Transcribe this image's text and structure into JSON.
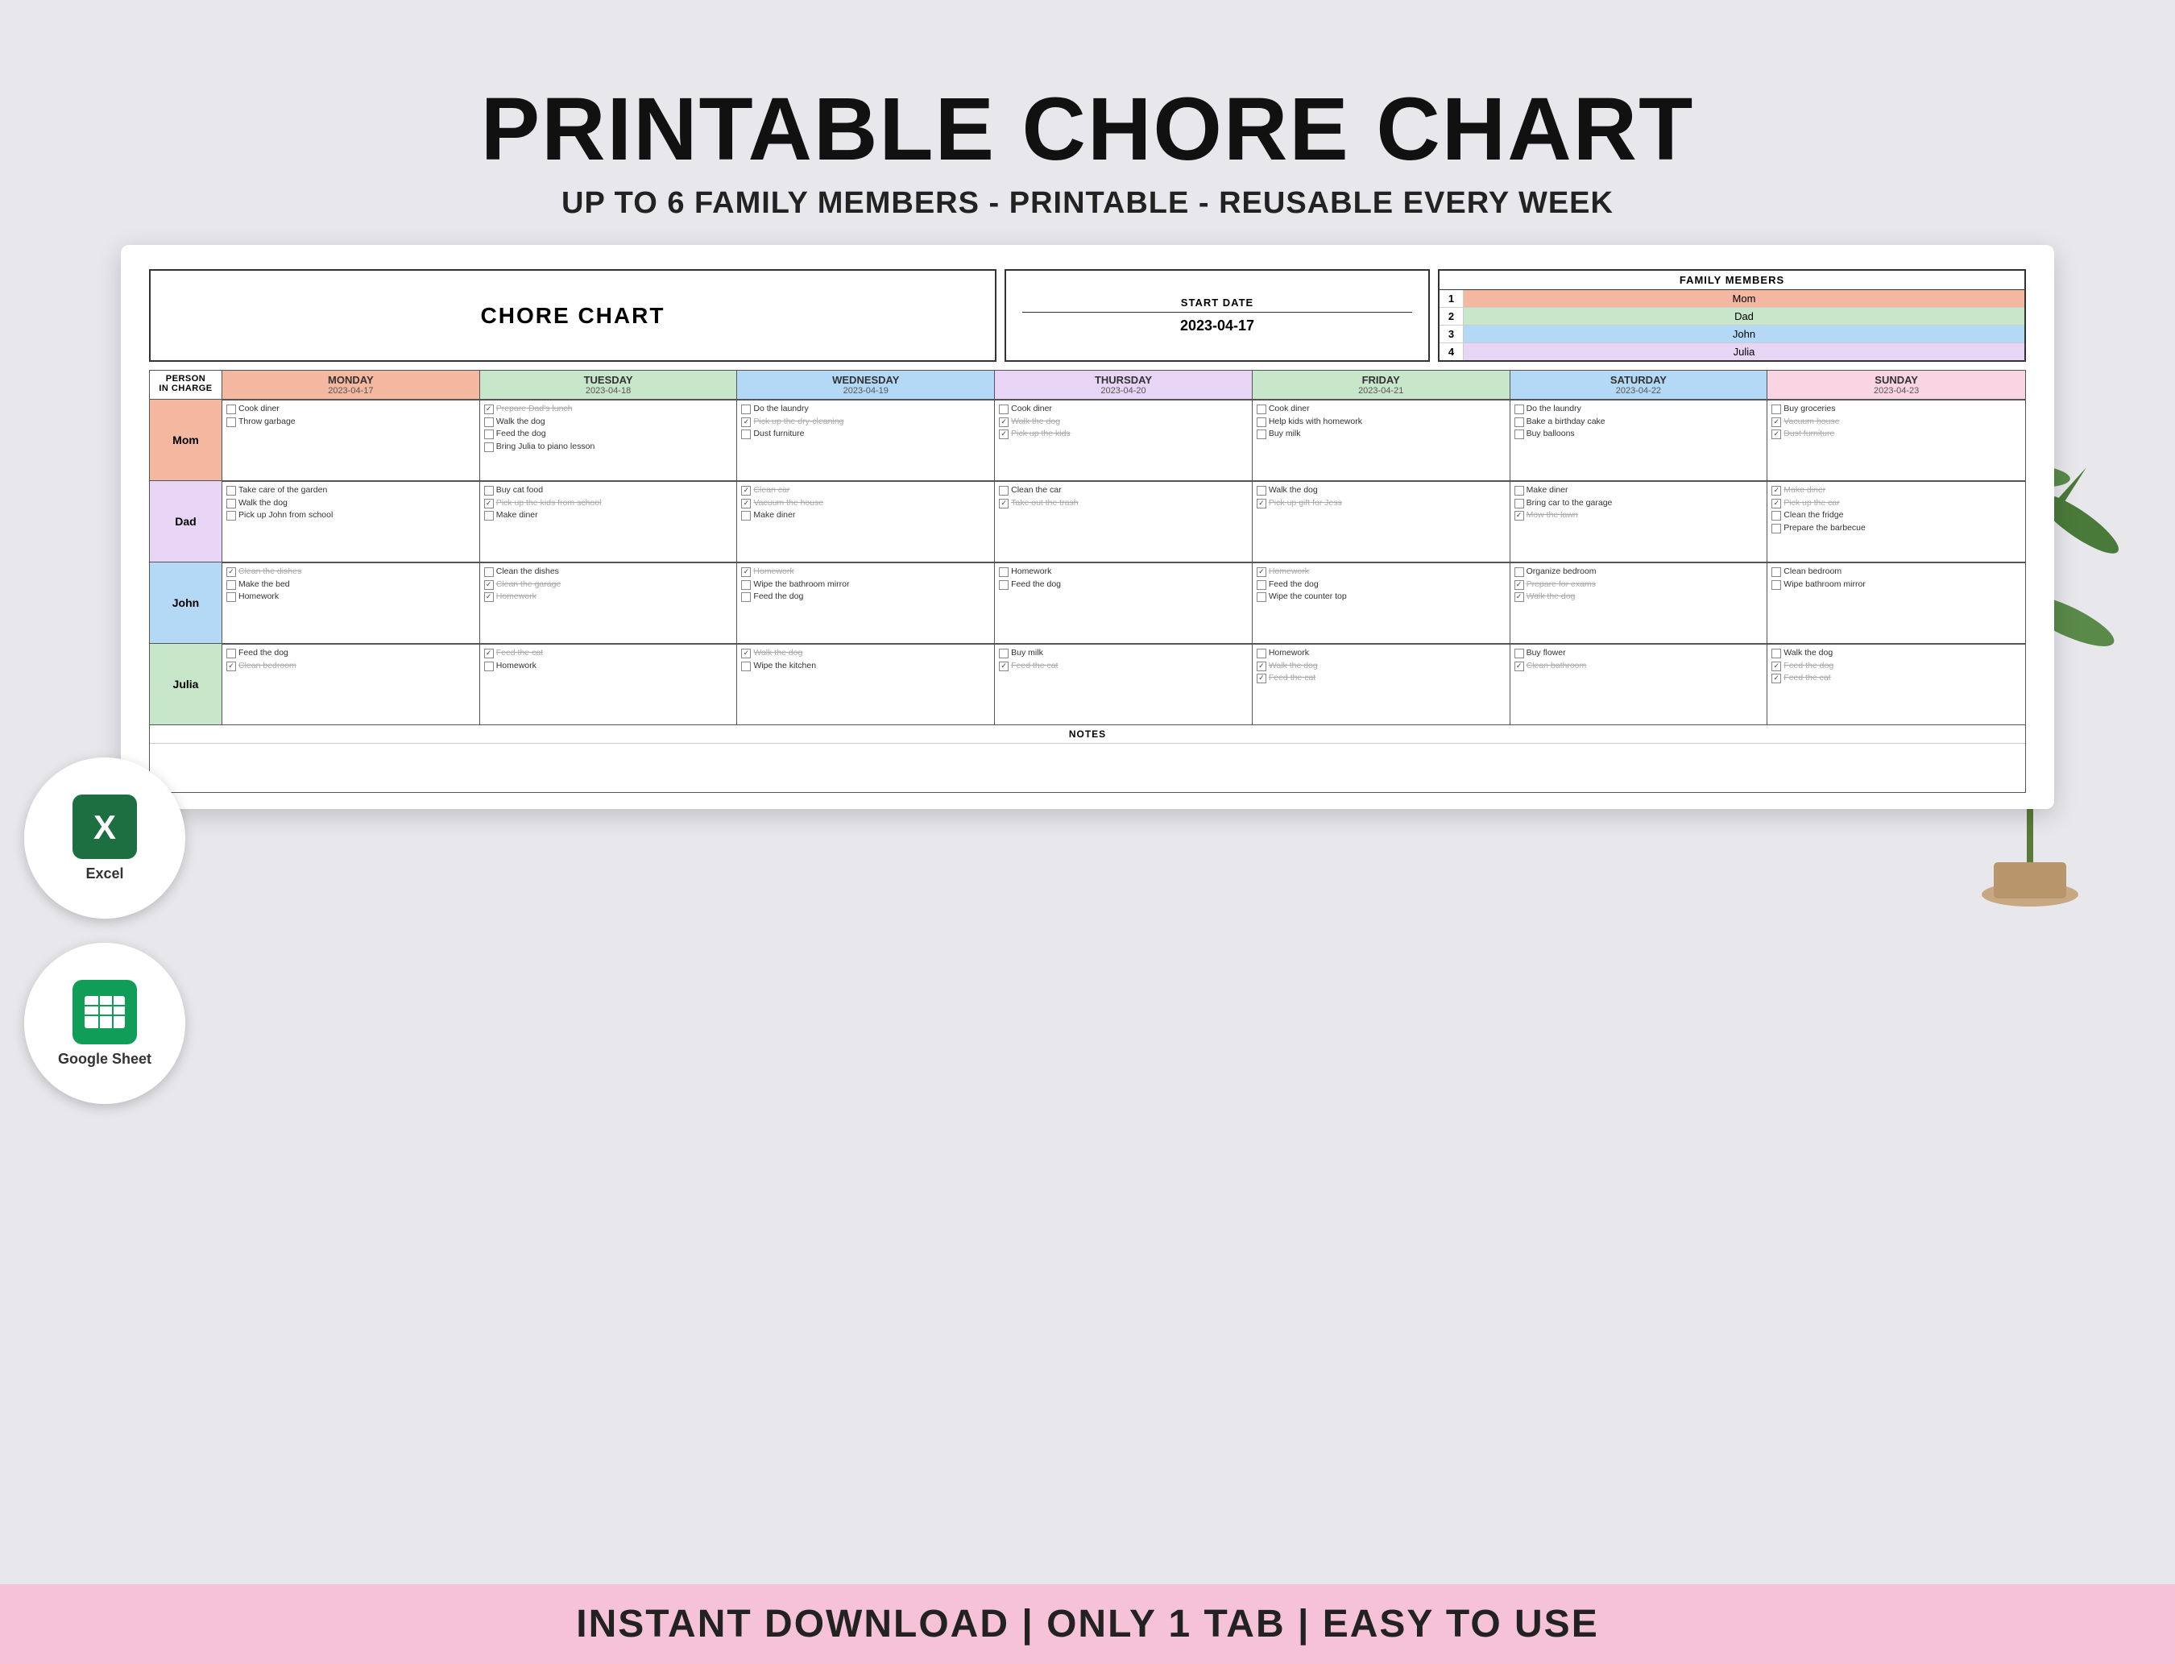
{
  "title": "PRINTABLE CHORE CHART",
  "subtitle": "UP TO 6 FAMILY MEMBERS - PRINTABLE - REUSABLE EVERY WEEK",
  "header": {
    "chore_chart_label": "CHORE CHART",
    "start_date_label": "START DATE",
    "start_date_value": "2023-04-17",
    "family_members_label": "FAMILY MEMBERS",
    "family_members": [
      {
        "num": "1",
        "name": "Mom",
        "class": "fm-mom"
      },
      {
        "num": "2",
        "name": "Dad",
        "class": "fm-dad"
      },
      {
        "num": "3",
        "name": "John",
        "class": "fm-john"
      },
      {
        "num": "4",
        "name": "Julia",
        "class": "fm-julia"
      }
    ]
  },
  "days": [
    {
      "name": "MONDAY",
      "date": "2023-04-17",
      "bg": "monday-bg"
    },
    {
      "name": "TUESDAY",
      "date": "2023-04-18",
      "bg": "tuesday-bg"
    },
    {
      "name": "WEDNESDAY",
      "date": "2023-04-19",
      "bg": "wednesday-bg"
    },
    {
      "name": "THURSDAY",
      "date": "2023-04-20",
      "bg": "thursday-bg"
    },
    {
      "name": "FRIDAY",
      "date": "2023-04-21",
      "bg": "friday-bg"
    },
    {
      "name": "SATURDAY",
      "date": "2023-04-22",
      "bg": "saturday-bg"
    },
    {
      "name": "SUNDAY",
      "date": "2023-04-23",
      "bg": "sunday-bg"
    }
  ],
  "persons": [
    {
      "name": "Mom",
      "label_class": "person-label-mom",
      "tasks": [
        [
          {
            "text": "Cook diner",
            "checked": false,
            "strike": false
          },
          {
            "text": "Throw garbage",
            "checked": false,
            "strike": false
          }
        ],
        [
          {
            "text": "Prepare Dad's lunch",
            "checked": true,
            "strike": true
          },
          {
            "text": "Walk the dog",
            "checked": false,
            "strike": false
          },
          {
            "text": "Feed the dog",
            "checked": false,
            "strike": false
          },
          {
            "text": "Bring Julia to piano lesson",
            "checked": false,
            "strike": false
          }
        ],
        [
          {
            "text": "Do the laundry",
            "checked": false,
            "strike": false
          },
          {
            "text": "Pick up the dry-cleaning",
            "checked": true,
            "strike": true
          },
          {
            "text": "Dust furniture",
            "checked": false,
            "strike": false
          }
        ],
        [
          {
            "text": "Cook diner",
            "checked": false,
            "strike": false
          },
          {
            "text": "Walk the dog",
            "checked": true,
            "strike": true
          },
          {
            "text": "Pick up the kids",
            "checked": true,
            "strike": true
          }
        ],
        [
          {
            "text": "Cook diner",
            "checked": false,
            "strike": false
          },
          {
            "text": "Help kids with homework",
            "checked": false,
            "strike": false
          },
          {
            "text": "Buy milk",
            "checked": false,
            "strike": false
          }
        ],
        [
          {
            "text": "Do the laundry",
            "checked": false,
            "strike": false
          },
          {
            "text": "Bake a birthday cake",
            "checked": false,
            "strike": false
          },
          {
            "text": "Buy balloons",
            "checked": false,
            "strike": false
          }
        ],
        [
          {
            "text": "Buy groceries",
            "checked": false,
            "strike": false
          },
          {
            "text": "Vacuum house",
            "checked": true,
            "strike": true
          },
          {
            "text": "Dust furniture",
            "checked": true,
            "strike": true
          }
        ]
      ]
    },
    {
      "name": "Dad",
      "label_class": "person-label-dad",
      "tasks": [
        [
          {
            "text": "Take care of the garden",
            "checked": false,
            "strike": false
          },
          {
            "text": "Walk the dog",
            "checked": false,
            "strike": false
          },
          {
            "text": "Pick up John from school",
            "checked": false,
            "strike": false
          }
        ],
        [
          {
            "text": "Buy cat food",
            "checked": false,
            "strike": false
          },
          {
            "text": "Pick up the kids from school",
            "checked": true,
            "strike": true
          },
          {
            "text": "Make diner",
            "checked": false,
            "strike": false
          }
        ],
        [
          {
            "text": "Clean car",
            "checked": true,
            "strike": true
          },
          {
            "text": "Vacuum the house",
            "checked": true,
            "strike": true
          },
          {
            "text": "Make diner",
            "checked": false,
            "strike": false
          }
        ],
        [
          {
            "text": "Clean the car",
            "checked": false,
            "strike": false
          },
          {
            "text": "Take out the trash",
            "checked": true,
            "strike": true
          }
        ],
        [
          {
            "text": "Walk the dog",
            "checked": false,
            "strike": false
          },
          {
            "text": "Pick up gift for Jess",
            "checked": true,
            "strike": true
          }
        ],
        [
          {
            "text": "Make diner",
            "checked": false,
            "strike": false
          },
          {
            "text": "Bring car to the garage",
            "checked": false,
            "strike": false
          },
          {
            "text": "Mow the lawn",
            "checked": true,
            "strike": true
          }
        ],
        [
          {
            "text": "Make diner",
            "checked": true,
            "strike": true
          },
          {
            "text": "Pick up the car",
            "checked": true,
            "strike": true
          },
          {
            "text": "Clean the fridge",
            "checked": false,
            "strike": false
          },
          {
            "text": "Prepare the barbecue",
            "checked": false,
            "strike": false
          }
        ]
      ]
    },
    {
      "name": "John",
      "label_class": "person-label-john",
      "tasks": [
        [
          {
            "text": "Clean the dishes",
            "checked": true,
            "strike": true
          },
          {
            "text": "Make the bed",
            "checked": false,
            "strike": false
          },
          {
            "text": "Homework",
            "checked": false,
            "strike": false
          }
        ],
        [
          {
            "text": "Clean the dishes",
            "checked": false,
            "strike": false
          },
          {
            "text": "Clean the garage",
            "checked": true,
            "strike": true
          },
          {
            "text": "Homework",
            "checked": true,
            "strike": true
          }
        ],
        [
          {
            "text": "Homework",
            "checked": true,
            "strike": true
          },
          {
            "text": "Wipe the bathroom mirror",
            "checked": false,
            "strike": false
          },
          {
            "text": "Feed the dog",
            "checked": false,
            "strike": false
          }
        ],
        [
          {
            "text": "Homework",
            "checked": false,
            "strike": false
          },
          {
            "text": "Feed the dog",
            "checked": false,
            "strike": false
          }
        ],
        [
          {
            "text": "Homework",
            "checked": true,
            "strike": true
          },
          {
            "text": "Feed the dog",
            "checked": false,
            "strike": false
          },
          {
            "text": "Wipe the counter top",
            "checked": false,
            "strike": false
          }
        ],
        [
          {
            "text": "Organize bedroom",
            "checked": false,
            "strike": false
          },
          {
            "text": "Prepare for exams",
            "checked": true,
            "strike": true
          },
          {
            "text": "Walk the dog",
            "checked": true,
            "strike": true
          }
        ],
        [
          {
            "text": "Clean bedroom",
            "checked": false,
            "strike": false
          },
          {
            "text": "Wipe bathroom mirror",
            "checked": false,
            "strike": false
          }
        ]
      ]
    },
    {
      "name": "Julia",
      "label_class": "person-label-julia",
      "tasks": [
        [
          {
            "text": "Feed the dog",
            "checked": false,
            "strike": false
          },
          {
            "text": "Clean bedroom",
            "checked": true,
            "strike": true
          }
        ],
        [
          {
            "text": "Feed the cat",
            "checked": true,
            "strike": true
          },
          {
            "text": "Homework",
            "checked": false,
            "strike": false
          }
        ],
        [
          {
            "text": "Walk the dog",
            "checked": true,
            "strike": true
          },
          {
            "text": "Wipe the kitchen",
            "checked": false,
            "strike": false
          }
        ],
        [
          {
            "text": "Buy milk",
            "checked": false,
            "strike": false
          },
          {
            "text": "Feed the cat",
            "checked": true,
            "strike": true
          }
        ],
        [
          {
            "text": "Homework",
            "checked": false,
            "strike": false
          },
          {
            "text": "Walk the dog",
            "checked": true,
            "strike": true
          },
          {
            "text": "Feed the cat",
            "checked": true,
            "strike": true
          }
        ],
        [
          {
            "text": "Buy flower",
            "checked": false,
            "strike": false
          },
          {
            "text": "Clean bathroom",
            "checked": true,
            "strike": true
          }
        ],
        [
          {
            "text": "Walk the dog",
            "checked": false,
            "strike": false
          },
          {
            "text": "Feed the dog",
            "checked": true,
            "strike": true
          },
          {
            "text": "Feed the cat",
            "checked": true,
            "strike": true
          }
        ]
      ]
    }
  ],
  "notes_label": "NOTES",
  "badges": [
    {
      "label": "Excel",
      "color": "#1d6f42"
    },
    {
      "label": "Google Sheet",
      "color": "#0f9d58"
    }
  ],
  "bottom_banner": "INSTANT DOWNLOAD  |  ONLY 1 TAB  |  EASY TO USE"
}
